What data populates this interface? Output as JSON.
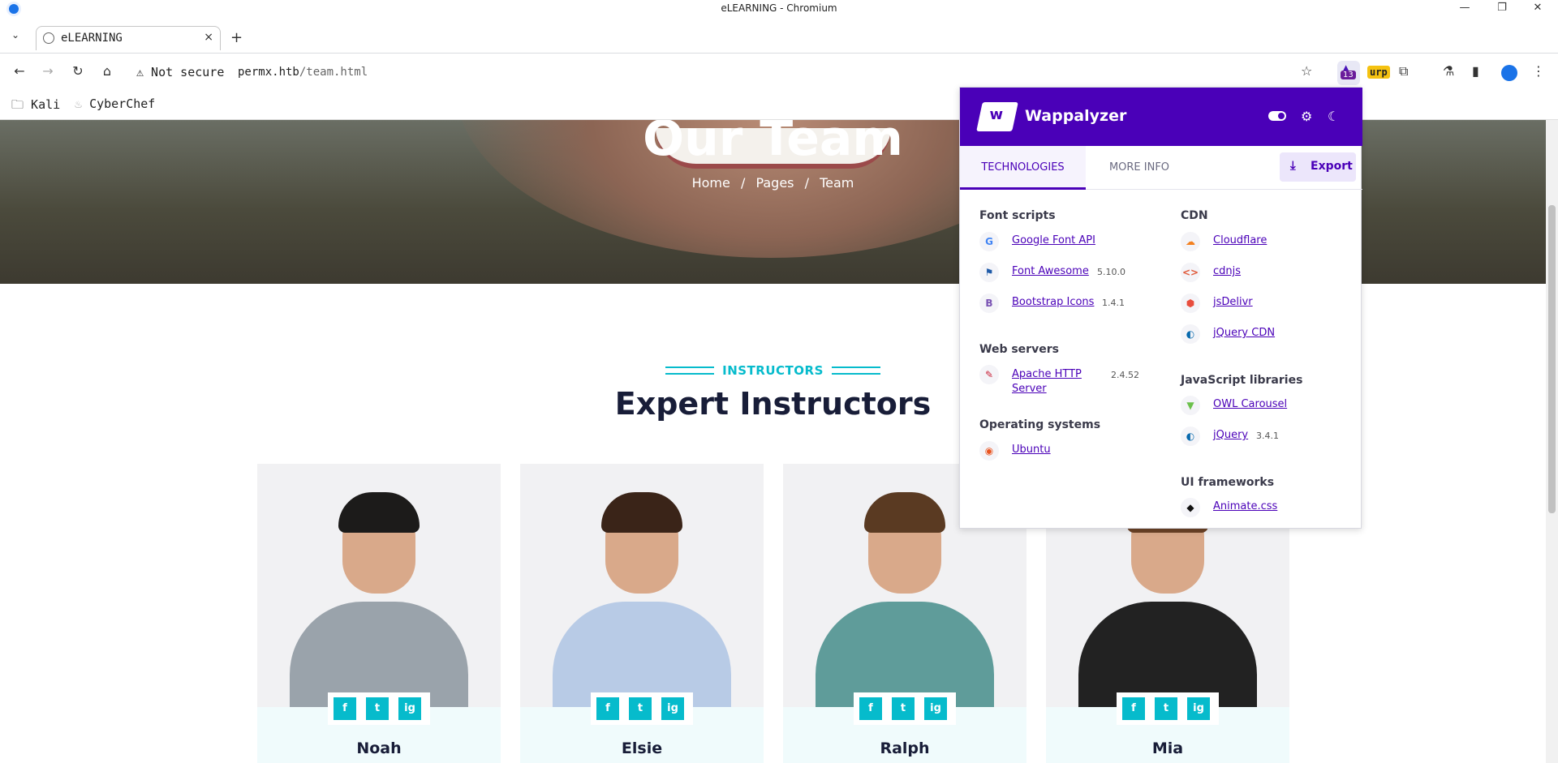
{
  "window": {
    "title": "eLEARNING - Chromium"
  },
  "tab": {
    "label": "eLEARNING",
    "close": "×",
    "new_tab": "+"
  },
  "toolbar": {
    "security_warning": "⚠ Not secure",
    "url_host": "permx.htb",
    "url_path": "/team.html",
    "extension_count": "13",
    "burp_label": "urp"
  },
  "bookmarks": [
    {
      "label": "Kali"
    },
    {
      "label": "CyberChef"
    }
  ],
  "hero": {
    "title": "Our Team",
    "breadcrumb": [
      "Home",
      "/",
      "Pages",
      "/",
      "Team"
    ]
  },
  "section": {
    "subtitle": "INSTRUCTORS",
    "title": "Expert Instructors"
  },
  "instructors": [
    {
      "name": "Noah",
      "shirt": "#9aa3ab",
      "hair": "#1c1b1a"
    },
    {
      "name": "Elsie",
      "shirt": "#b8cbe6",
      "hair": "#3a2418"
    },
    {
      "name": "Ralph",
      "shirt": "#5f9c9a",
      "hair": "#5a3a22"
    },
    {
      "name": "Mia",
      "shirt": "#222222",
      "hair": "#6b4226"
    }
  ],
  "social_icons": [
    "f",
    "t",
    "ig"
  ],
  "wappalyzer": {
    "brand": "Wappalyzer",
    "tabs": {
      "technologies": "TECHNOLOGIES",
      "more_info": "MORE INFO"
    },
    "export_label": "Export",
    "left_column": [
      {
        "category": "Font scripts",
        "items": [
          {
            "name": "Google Font API",
            "version": "",
            "icon": "G",
            "color": "#4285f4"
          },
          {
            "name": "Font Awesome",
            "version": "5.10.0",
            "icon": "⚑",
            "color": "#1e5aa8"
          },
          {
            "name": "Bootstrap Icons",
            "version": "1.4.1",
            "icon": "B",
            "color": "#7952b3"
          }
        ]
      },
      {
        "category": "Web servers",
        "items": [
          {
            "name": "Apache HTTP Server",
            "version": "2.4.52",
            "icon": "✎",
            "color": "#c92037"
          }
        ]
      },
      {
        "category": "Operating systems",
        "items": [
          {
            "name": "Ubuntu",
            "version": "",
            "icon": "◉",
            "color": "#e95420"
          }
        ]
      }
    ],
    "right_column": [
      {
        "category": "CDN",
        "items": [
          {
            "name": "Cloudflare",
            "version": "",
            "icon": "☁",
            "color": "#f38020"
          },
          {
            "name": "cdnjs",
            "version": "",
            "icon": "<>",
            "color": "#e05a3a"
          },
          {
            "name": "jsDelivr",
            "version": "",
            "icon": "⬢",
            "color": "#e84d3d"
          },
          {
            "name": "jQuery CDN",
            "version": "",
            "icon": "◐",
            "color": "#0769ad"
          }
        ]
      },
      {
        "category": "JavaScript libraries",
        "items": [
          {
            "name": "OWL Carousel",
            "version": "",
            "icon": "▼",
            "color": "#6bc04b"
          },
          {
            "name": "jQuery",
            "version": "3.4.1",
            "icon": "◐",
            "color": "#0769ad"
          }
        ]
      },
      {
        "category": "UI frameworks",
        "items": [
          {
            "name": "Animate.css",
            "version": "",
            "icon": "◆",
            "color": "#111111"
          }
        ]
      }
    ]
  }
}
